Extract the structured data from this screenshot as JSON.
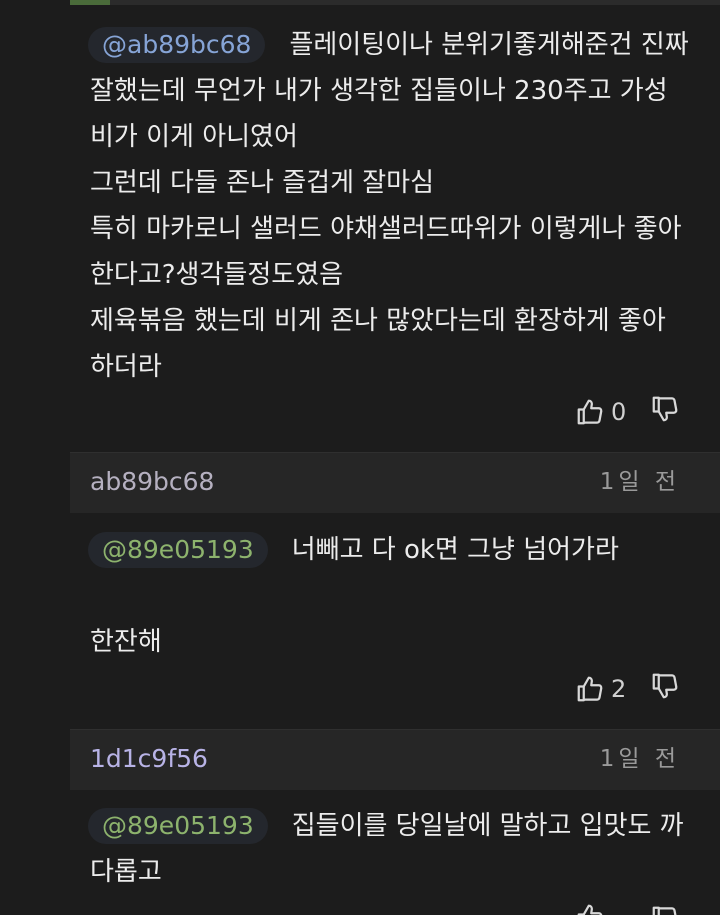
{
  "comments": [
    {
      "mention": "@ab89bc68",
      "lines": [
        "플레이팅이나 분위기좋게해준건 진짜",
        "잘했는데 무언가 내가 생각한 집들이나 230주고 가성",
        "비가 이게 아니였어",
        "그런데 다들 존나 즐겁게 잘마심",
        "특히 마카로니 샐러드 야채샐러드따위가 이렇게나 좋아",
        "한다고?생각들정도였음",
        "제육볶음 했는데 비게 존나 많았다는데 환장하게 좋아",
        "하더라"
      ],
      "likes": "0"
    },
    {
      "author": "ab89bc68",
      "time": "1일 전",
      "mention": "@89e05193",
      "lines": [
        "너빼고 다 ok면 그냥 넘어가라",
        "",
        "한잔해"
      ],
      "likes": "2"
    },
    {
      "author": "1d1c9f56",
      "time": "1일 전",
      "mention": "@89e05193",
      "lines": [
        "집들이를 당일날에 말하고 입맛도 까",
        "다롭고"
      ]
    }
  ],
  "colors": {
    "background": "#1c1c1c",
    "header": "#262626",
    "mention_blue": "#86a4d6",
    "mention_green": "#8db36d",
    "text": "#ececec"
  },
  "icons": [
    "thumbs-up-icon",
    "thumbs-down-icon"
  ]
}
